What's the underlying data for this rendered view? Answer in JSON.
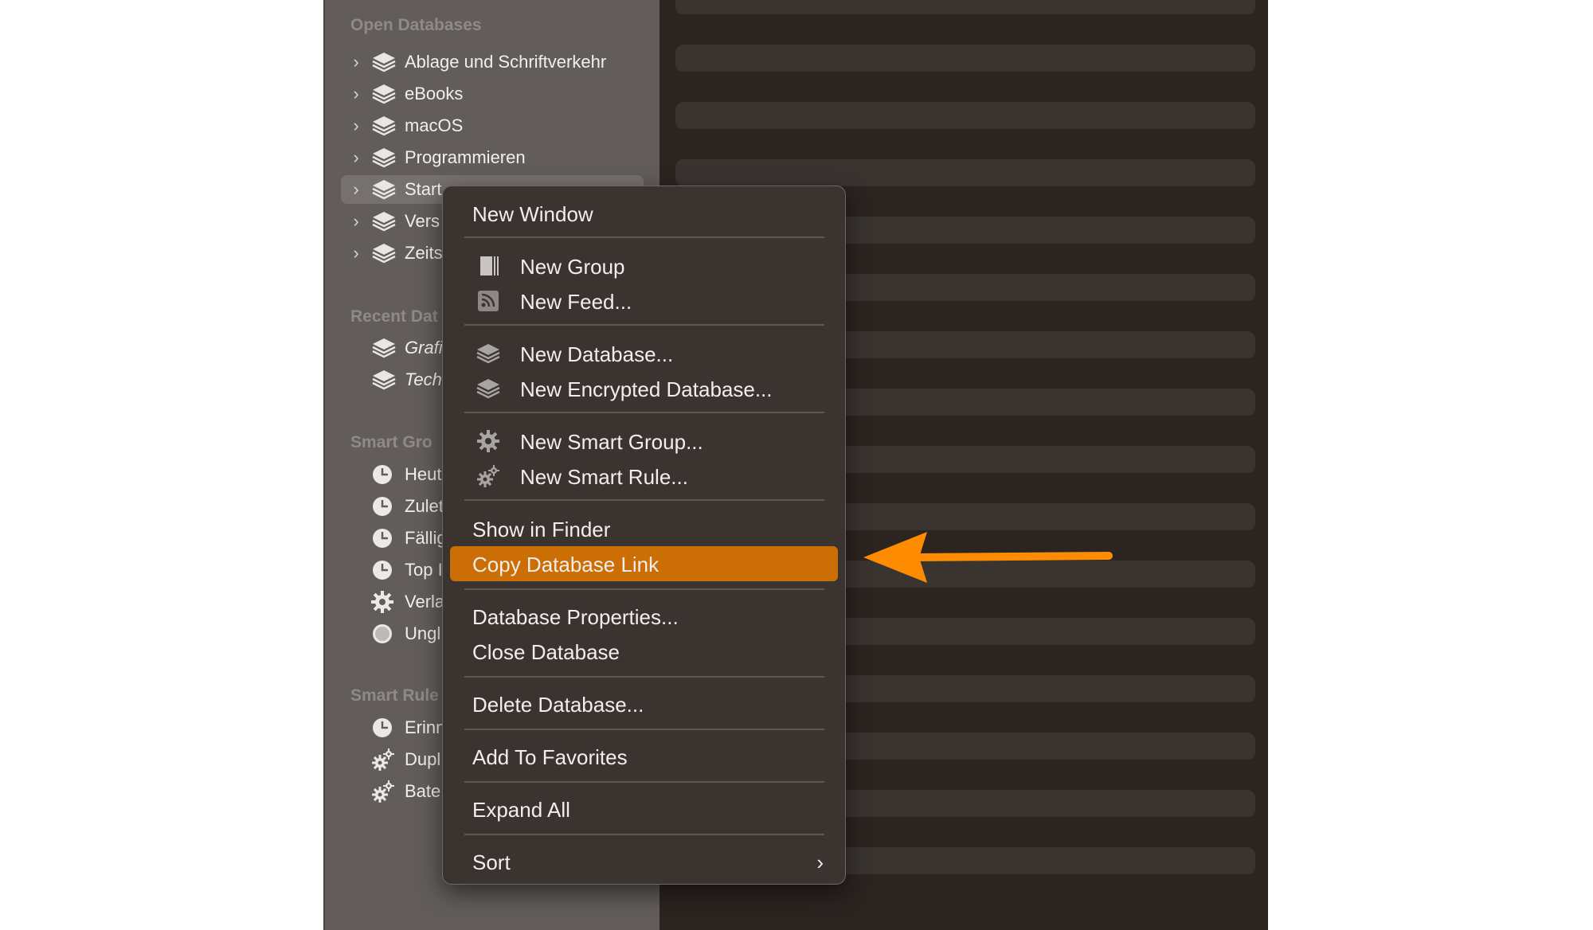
{
  "sidebar": {
    "open_title": "Open Databases",
    "open_items": [
      {
        "label": "Ablage und Schriftverkehr",
        "icon": "database-icon"
      },
      {
        "label": "eBooks",
        "icon": "database-icon"
      },
      {
        "label": "macOS",
        "icon": "database-icon"
      },
      {
        "label": "Programmieren",
        "icon": "database-icon"
      },
      {
        "label": "Start",
        "icon": "database-icon",
        "selected": true
      },
      {
        "label": "Vers",
        "icon": "database-icon"
      },
      {
        "label": "Zeits",
        "icon": "database-icon"
      }
    ],
    "recent_title": "Recent Dat",
    "recent_items": [
      {
        "label": "Grafi",
        "icon": "database-icon"
      },
      {
        "label": "Tech",
        "icon": "database-icon"
      }
    ],
    "smart_groups_title": "Smart Gro",
    "smart_groups": [
      {
        "label": "Heut",
        "icon": "clock-icon"
      },
      {
        "label": "Zulet",
        "icon": "clock-icon"
      },
      {
        "label": "Fällig",
        "icon": "clock-icon"
      },
      {
        "label": "Top I",
        "icon": "clock-icon"
      },
      {
        "label": "Verla",
        "icon": "gear-icon"
      },
      {
        "label": "Ungl",
        "icon": "circle-icon"
      }
    ],
    "smart_rules_title": "Smart Rule",
    "smart_rules": [
      {
        "label": "Erinn",
        "icon": "clock-icon"
      },
      {
        "label": "Dupl",
        "icon": "gears-icon"
      },
      {
        "label": "Bate",
        "icon": "gears-icon"
      }
    ]
  },
  "menu": {
    "new_window": "New Window",
    "new_group": "New Group",
    "new_feed": "New Feed...",
    "new_database": "New Database...",
    "new_encrypted_database": "New Encrypted Database...",
    "new_smart_group": "New Smart Group...",
    "new_smart_rule": "New Smart Rule...",
    "show_in_finder": "Show in Finder",
    "copy_database_link": "Copy Database Link",
    "database_properties": "Database Properties...",
    "close_database": "Close Database",
    "delete_database": "Delete Database...",
    "add_to_favorites": "Add To Favorites",
    "expand_all": "Expand All",
    "sort": "Sort",
    "sort_submenu_glyph": "›"
  },
  "colors": {
    "highlight": "#cb6e06",
    "arrow": "#ff8c00",
    "sidebar_bg": "#625d5a",
    "content_bg": "#2b2421"
  }
}
